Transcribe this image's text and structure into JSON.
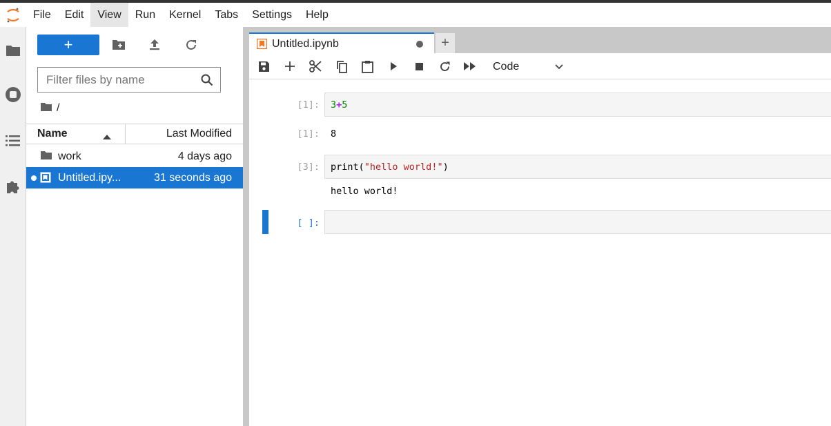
{
  "menubar": {
    "items": [
      "File",
      "Edit",
      "View",
      "Run",
      "Kernel",
      "Tabs",
      "Settings",
      "Help"
    ],
    "active": "View"
  },
  "filebrowser": {
    "new_label": "+",
    "filter_placeholder": "Filter files by name",
    "breadcrumb": "/",
    "columns": {
      "name": "Name",
      "modified": "Last Modified"
    },
    "rows": [
      {
        "name": "work",
        "modified": "4 days ago",
        "type": "folder",
        "selected": false
      },
      {
        "name": "Untitled.ipy...",
        "modified": "31 seconds ago",
        "type": "notebook",
        "selected": true
      }
    ]
  },
  "tab": {
    "title": "Untitled.ipynb",
    "add_label": "+"
  },
  "toolbar": {
    "cell_type": "Code"
  },
  "cells": [
    {
      "prompt": "[1]:",
      "code": {
        "a": "3",
        "op": "+",
        "b": "5"
      },
      "out_prompt": "[1]:",
      "output": "8"
    },
    {
      "prompt": "[3]:",
      "code": {
        "fn": "print(",
        "str": "\"hello world!\"",
        "close": ")"
      },
      "output": "hello world!"
    },
    {
      "prompt": "[ ]:",
      "code": ""
    }
  ],
  "colors": {
    "accent": "#1976d2",
    "tab_icon": "#f37726",
    "logo": "#f37726"
  },
  "icons": [
    "jupyter-logo",
    "folder-icon",
    "running-icon",
    "toc-icon",
    "extension-icon",
    "new-folder-icon",
    "upload-icon",
    "refresh-icon",
    "search-icon",
    "save-icon",
    "add-cell-icon",
    "cut-icon",
    "copy-icon",
    "paste-icon",
    "run-icon",
    "stop-icon",
    "restart-icon",
    "fast-forward-icon",
    "chevron-down-icon"
  ]
}
